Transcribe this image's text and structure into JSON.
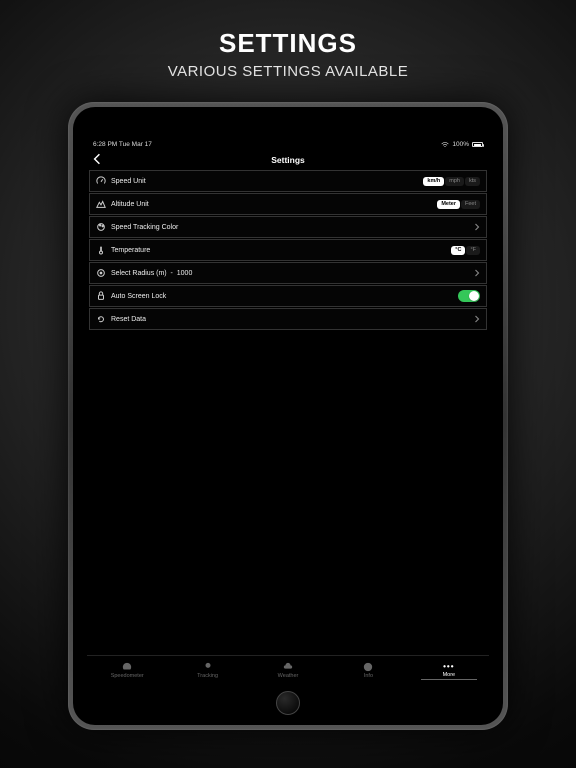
{
  "hero": {
    "title": "SETTINGS",
    "subtitle": "VARIOUS SETTINGS AVAILABLE"
  },
  "status": {
    "time_date": "6:28 PM  Tue Mar 17",
    "battery_pct": "100%"
  },
  "nav": {
    "title": "Settings"
  },
  "rows": {
    "speed_unit": {
      "label": "Speed Unit",
      "options": [
        "km/h",
        "mph",
        "kts"
      ],
      "selected": "km/h"
    },
    "altitude_unit": {
      "label": "Altitude Unit",
      "options": [
        "Meter",
        "Feet"
      ],
      "selected": "Meter"
    },
    "tracking_color": {
      "label": "Speed Tracking Color"
    },
    "temperature": {
      "label": "Temperature",
      "options": [
        "°C",
        "°F"
      ],
      "selected": "°C"
    },
    "radius": {
      "label": "Select Radius (m)",
      "value": "1000"
    },
    "autolock": {
      "label": "Auto Screen Lock",
      "on": true
    },
    "reset": {
      "label": "Reset Data"
    }
  },
  "tabs": {
    "speedometer": "Speedometer",
    "tracking": "Tracking",
    "weather": "Weather",
    "info": "Info",
    "more": "More"
  }
}
